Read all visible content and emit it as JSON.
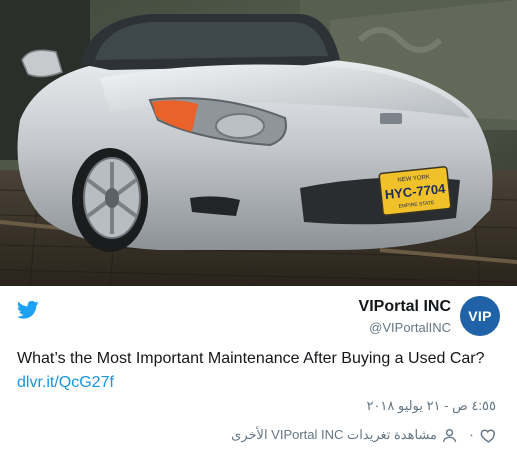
{
  "account": {
    "name": "VIPortal INC",
    "handle": "@VIPortalINC",
    "avatar_text": "VIP"
  },
  "tweet": {
    "text": "What’s the Most Important Maintenance After Buying a Used Car?",
    "link": "dlvr.it/QcG27f",
    "timestamp": "٤:٥٥ ص - ٢١ يوليو ٢٠١٨"
  },
  "photo": {
    "plate_state": "NEW YORK",
    "plate_number": "HYC-7704",
    "plate_slogan": "EMPIRE STATE"
  },
  "actions": {
    "like_count": "٠",
    "other_tweets_label": "مشاهدة تغريدات VIPortal INC الأخرى"
  },
  "icons": {
    "brand": "twitter-bird-icon",
    "like": "heart-icon",
    "profile": "person-icon"
  },
  "colors": {
    "brand_blue": "#1da1f2",
    "link_blue": "#1b95e0",
    "avatar_blue": "#1f62a7",
    "text_dark": "#14171a",
    "text_gray": "#657786"
  }
}
